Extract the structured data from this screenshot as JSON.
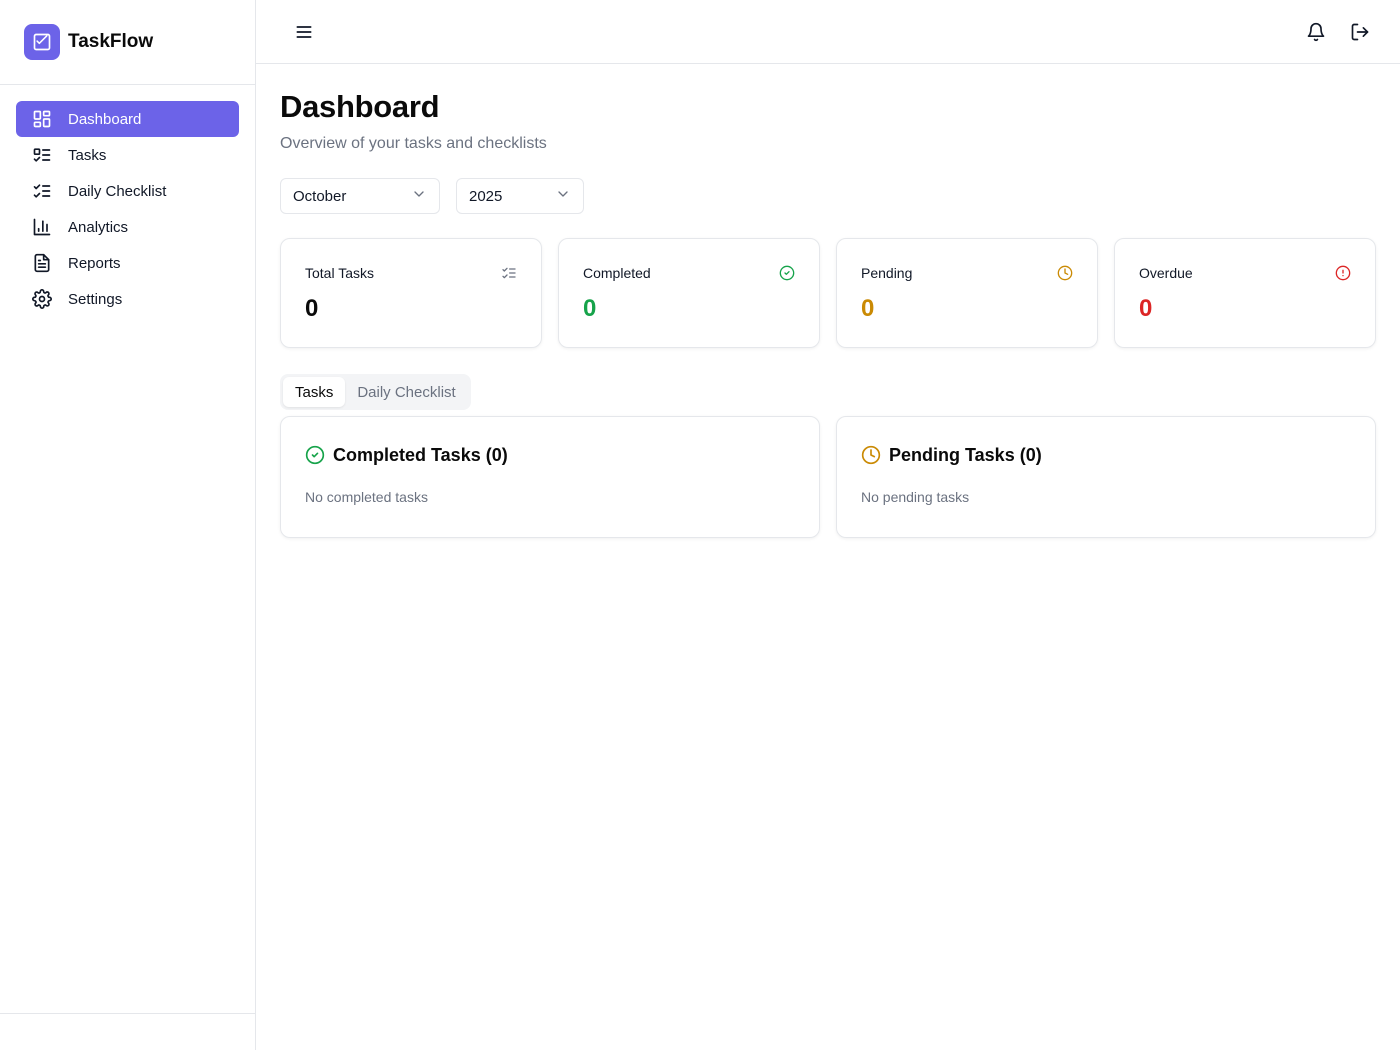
{
  "app": {
    "name": "TaskFlow",
    "logo_icon": "checkbox-icon",
    "accent": "#6c63e8"
  },
  "sidebar": {
    "items": [
      {
        "label": "Dashboard",
        "icon": "layout-dashboard-icon",
        "active": true
      },
      {
        "label": "Tasks",
        "icon": "list-todo-icon"
      },
      {
        "label": "Daily Checklist",
        "icon": "list-checks-icon"
      },
      {
        "label": "Analytics",
        "icon": "bar-chart-icon"
      },
      {
        "label": "Reports",
        "icon": "file-text-icon"
      },
      {
        "label": "Settings",
        "icon": "gear-icon"
      }
    ]
  },
  "header": {
    "menu_icon": "hamburger-icon",
    "notifications_icon": "bell-icon",
    "logout_icon": "logout-icon"
  },
  "page": {
    "title": "Dashboard",
    "subtitle": "Overview of your tasks and checklists"
  },
  "filters": {
    "month": "October",
    "year": "2025"
  },
  "stats": [
    {
      "label": "Total Tasks",
      "value": "0",
      "icon": "list-checks-icon",
      "color": "#0a0a0a"
    },
    {
      "label": "Completed",
      "value": "0",
      "icon": "check-circle-icon",
      "color": "#16a34a"
    },
    {
      "label": "Pending",
      "value": "0",
      "icon": "clock-icon",
      "color": "#ca8a04"
    },
    {
      "label": "Overdue",
      "value": "0",
      "icon": "alert-circle-icon",
      "color": "#dc2626"
    }
  ],
  "tabs": [
    {
      "label": "Tasks",
      "active": true
    },
    {
      "label": "Daily Checklist",
      "active": false
    }
  ],
  "panels": {
    "completed": {
      "title": "Completed Tasks (0)",
      "empty": "No completed tasks",
      "color": "#16a34a"
    },
    "pending": {
      "title": "Pending Tasks (0)",
      "empty": "No pending tasks",
      "color": "#ca8a04"
    }
  }
}
